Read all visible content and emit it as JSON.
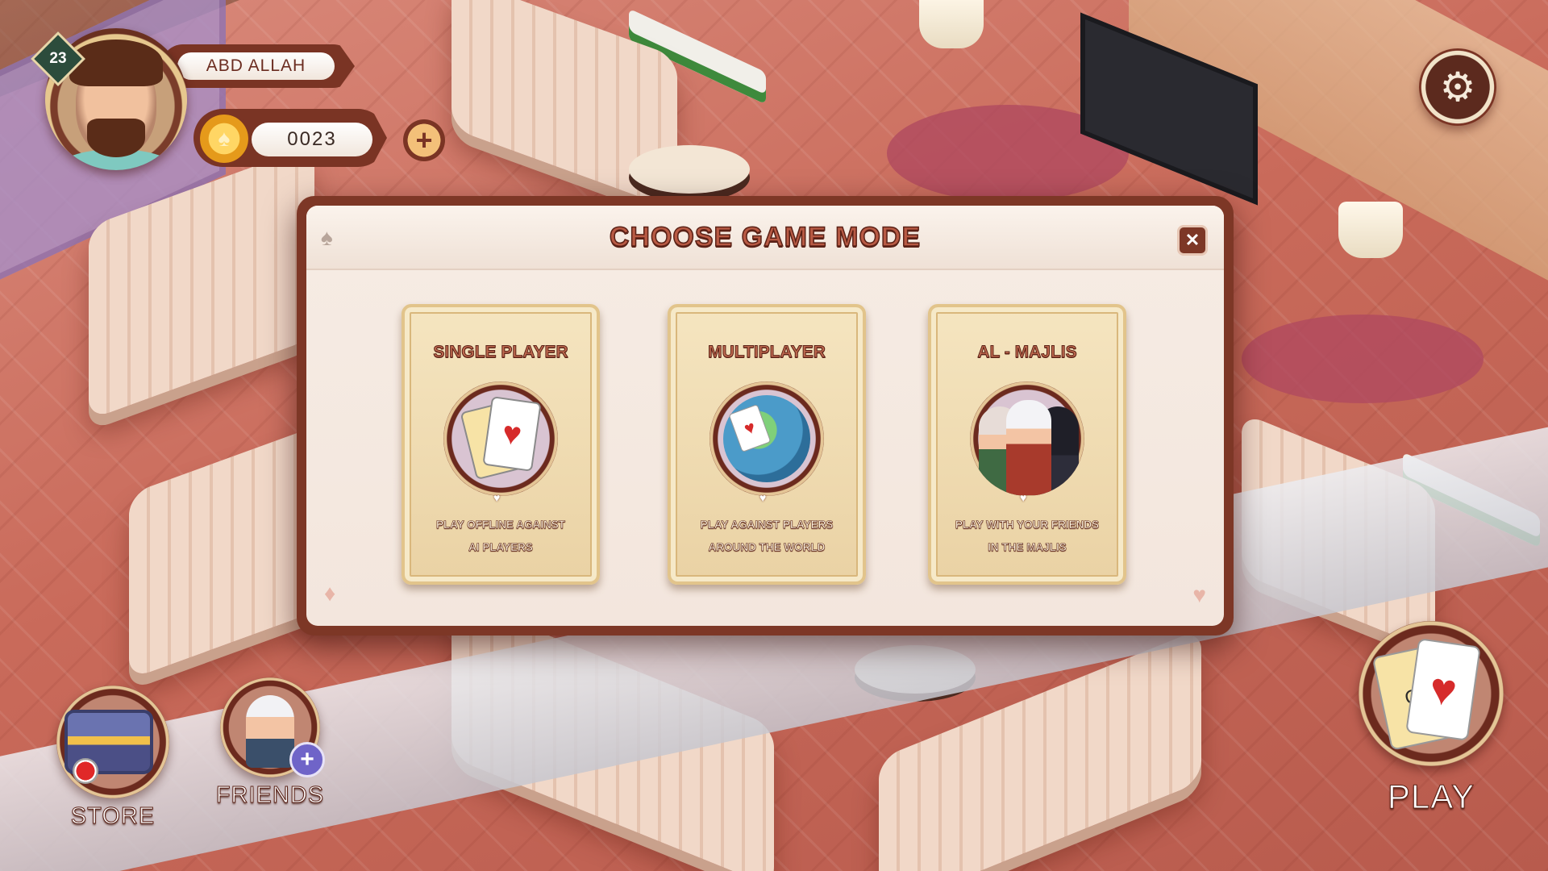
{
  "player": {
    "name": "ABD ALLAH",
    "level": "23",
    "coins": "0023"
  },
  "icons": {
    "coin": "coin-spade-icon",
    "add_coins": "plus-icon",
    "settings": "gear-icon",
    "close": "close-icon"
  },
  "modal": {
    "title": "CHOOSE GAME MODE",
    "close_label": "✕",
    "modes": [
      {
        "title": "SINGLE PLAYER",
        "desc_line1": "PLAY OFFLINE AGAINST",
        "desc_line2": "AI  PLAYERS",
        "icon": "playing-cards-icon"
      },
      {
        "title": "MULTIPLAYER",
        "desc_line1": "PLAY AGAINST PLAYERS",
        "desc_line2": "AROUND THE WORLD",
        "icon": "globe-icon"
      },
      {
        "title": "AL - MAJLIS",
        "desc_line1": "PLAY WITH YOUR FRIENDS",
        "desc_line2": "IN THE MAJLIS",
        "icon": "group-of-people-icon"
      }
    ]
  },
  "bottom_nav": {
    "store_label": "STORE",
    "friends_label": "FRIENDS",
    "play_label": "PLAY"
  },
  "colors": {
    "accent": "#7d3726",
    "title_text": "#b85a44",
    "card_bg": "#f5e5c0",
    "friend_plus": "#6f64c8",
    "notification": "#e02828"
  }
}
